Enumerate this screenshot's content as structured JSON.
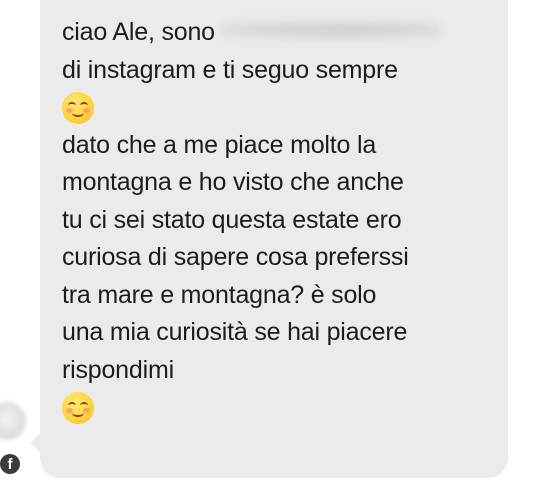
{
  "message": {
    "lines": [
      "ciao Ale, sono",
      "di instagram e ti seguo sempre",
      "dato che a me piace molto la",
      "montagna e ho visto che anche",
      "tu ci sei stato questa estate ero",
      "curiosa di sapere cosa preferssi",
      "tra mare e montagna? è solo",
      "una mia curiosità se hai piacere",
      "rispondimi"
    ],
    "emoji": "smiling-face-emoji"
  },
  "sender": {
    "badge": "f"
  },
  "colors": {
    "bubble_background": "#ebebeb",
    "text": "#1c1c1c"
  }
}
